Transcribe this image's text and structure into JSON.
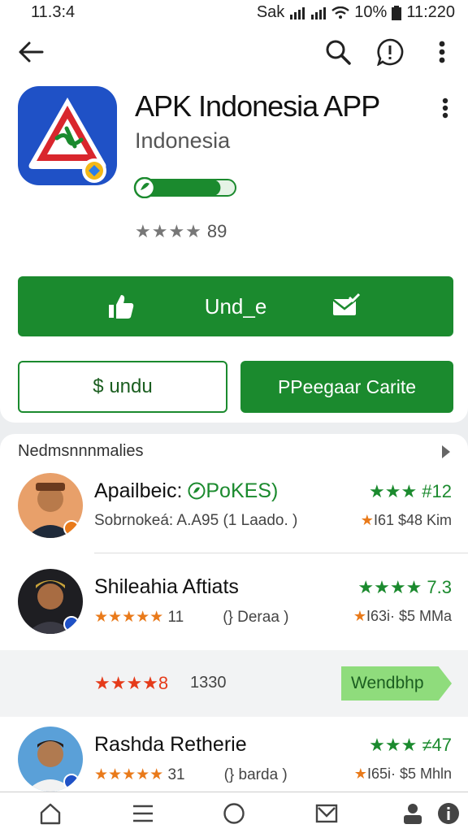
{
  "status_bar": {
    "time_left": "11.3:4",
    "carrier": "Sak",
    "battery": "10%",
    "time_right": "11:220"
  },
  "app_bar": {
    "back_icon": "arrow-left-icon",
    "search_icon": "search-icon",
    "feedback_icon": "feedback-icon",
    "menu_icon": "more-vert-icon"
  },
  "app": {
    "title": "APK Indonesia APP",
    "subtitle": "Indonesia",
    "rating_stars": "★★★★",
    "rating_count": "89",
    "progress": 0.85,
    "accent_color": "#1b8a2e"
  },
  "actions": {
    "primary_label": "Und_e",
    "secondary_label": "$ undu",
    "tertiary_label": "PPeegaar Carite"
  },
  "section": {
    "title": "Nedmsnnnmalies"
  },
  "reviews": [
    {
      "name": "Apailbeic: ",
      "badge": "PoKES)",
      "meta": "Sobrnokeá: A.A95   (1 Laado.  )",
      "right_top": "★★★ #12",
      "right_bot_star": "★",
      "right_bot_text": "I61  $48 Kim"
    },
    {
      "name": "Shileahia Aftiats",
      "stars": "★★★★★",
      "count": "11",
      "meta_right": "(} Deraa  )",
      "right_top": "★★★★ 7.3",
      "right_bot_star": "★",
      "right_bot_text": "I63i· $5 MMa"
    },
    {
      "name": "Rashda Retherie",
      "stars": "★★★★★",
      "count": "31",
      "meta_right": "(} barda  )",
      "right_top": "★★★ ≠47",
      "right_bot_star": "★",
      "right_bot_text": "I65i· $5 Mhln"
    }
  ],
  "promo": {
    "stars": "★★★★8",
    "count": "1330",
    "tag_label": "Wendbhp"
  },
  "nav": {
    "items": [
      "home-icon",
      "menu-icon",
      "circle-icon",
      "mail-icon",
      "profile-icon",
      "info-icon"
    ]
  }
}
